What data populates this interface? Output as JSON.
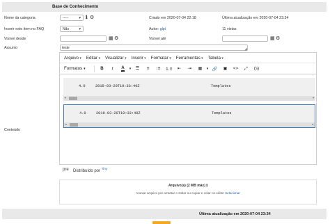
{
  "header": {
    "title": "Base de Conhecimento"
  },
  "fields": {
    "category_label": "Nome da categoria",
    "category_value": "-----",
    "created_label": "Criado em 2020-07-04 22:18",
    "updated_label": "Última atualização em 2020-07-04 23:34",
    "faq_label": "Inserir este item no FAQ",
    "faq_value": "Não",
    "author_label": "Autor:",
    "author_value": "glpi",
    "views_label": "11 vistas",
    "visible_from_label": "Visível desde",
    "visible_until_label": "Visível até",
    "subject_label": "Assunto",
    "subject_value": "teste",
    "content_label": "Conteúdo"
  },
  "editor": {
    "menu": [
      "Arquivo",
      "Editar",
      "Visualizar",
      "Inserir",
      "Formatar",
      "Ferramentas",
      "Tabela"
    ],
    "formats_label": "Formatos",
    "code_rows": [
      {
        "version": "4.0",
        "timestamp": "2019-03-20T19:33:40Z",
        "name": "Templates"
      },
      {
        "version": "4.0",
        "timestamp": "2019-03-20T19:33:40Z",
        "name": "Templates"
      }
    ],
    "path": "pre",
    "powered_by": "Distribuído por",
    "powered_by_brand": "Tiny"
  },
  "upload": {
    "title": "Arquivo(s) (2 MB máx)",
    "info_icon": "info-icon",
    "hint": "Anexar arquivo por arrastar e soltar ou copiar e colar no editor",
    "select_link": "Selecionar"
  },
  "footer": {
    "last_update": "Última atualização em 2020-07-04 23:34"
  },
  "colors": {
    "accent": "#f5a623",
    "header_bg": "#e9e9e9",
    "link": "#1a5ea8"
  }
}
